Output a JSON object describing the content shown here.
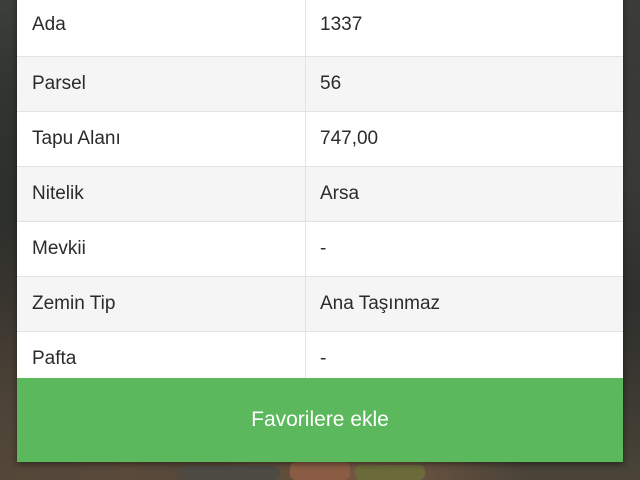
{
  "parcel_info": {
    "rows": [
      {
        "label": "Ada",
        "value": "1337"
      },
      {
        "label": "Parsel",
        "value": "56"
      },
      {
        "label": "Tapu Alanı",
        "value": "747,00"
      },
      {
        "label": "Nitelik",
        "value": "Arsa"
      },
      {
        "label": "Mevkii",
        "value": "-"
      },
      {
        "label": "Zemin Tip",
        "value": "Ana Taşınmaz"
      },
      {
        "label": "Pafta",
        "value": "-"
      }
    ]
  },
  "actions": {
    "add_favorites_label": "Favorilere ekle"
  },
  "colors": {
    "button_green": "#5cb85c",
    "row_shade": "#f5f5f5"
  }
}
